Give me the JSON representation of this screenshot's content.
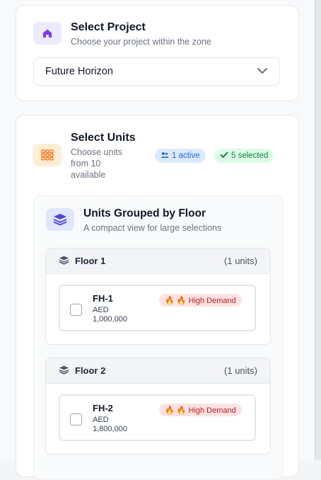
{
  "project_card": {
    "title": "Select Project",
    "subtitle": "Choose your project within the zone",
    "icon": "home-icon",
    "selected_project": "Future Horizon"
  },
  "units_card": {
    "title": "Select Units",
    "subtitle_lines": [
      "Choose units",
      "from 10",
      "available"
    ],
    "icon": "grid-icon",
    "badges": {
      "active": "1 active",
      "selected": "5 selected"
    },
    "grouped": {
      "title": "Units Grouped by Floor",
      "subtitle": "A compact view for large selections",
      "floors": [
        {
          "name": "Floor 1",
          "count": "(1 units)",
          "units": [
            {
              "code": "FH-1",
              "currency": "AED",
              "price": "1,000,000",
              "tag": "🔥 🔥 High Demand",
              "checked": false
            }
          ]
        },
        {
          "name": "Floor 2",
          "count": "(1 units)",
          "units": [
            {
              "code": "FH-2",
              "currency": "AED",
              "price": "1,800,000",
              "tag": "🔥 🔥 High Demand",
              "checked": false
            }
          ]
        }
      ]
    }
  },
  "colors": {
    "accent_purple": "#7c3aed",
    "accent_orange": "#f97316",
    "badge_blue": "#2563eb",
    "badge_green": "#15803d",
    "demand_red": "#b91c1c"
  }
}
